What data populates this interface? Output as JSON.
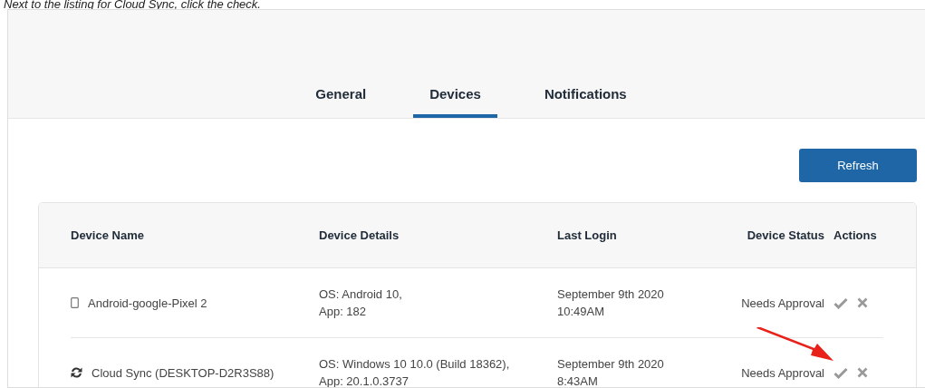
{
  "instruction": "Next to the listing for Cloud Sync, click the check.",
  "tabs": [
    {
      "label": "General",
      "selected": false
    },
    {
      "label": "Devices",
      "selected": true
    },
    {
      "label": "Notifications",
      "selected": false
    }
  ],
  "refresh_button": "Refresh",
  "table": {
    "columns": [
      "Device Name",
      "Device Details",
      "Last Login",
      "Device Status",
      "Actions"
    ],
    "rows": [
      {
        "kind": "phone",
        "name": "Android-google-Pixel 2",
        "details": [
          "OS: Android 10,",
          "App: 182"
        ],
        "last_login": [
          "September 9th 2020",
          "10:49AM"
        ],
        "status": "Needs Approval",
        "annotated": false
      },
      {
        "kind": "sync",
        "name": "Cloud Sync (DESKTOP-D2R3S88)",
        "details": [
          "OS: Windows 10 10.0 (Build 18362),",
          "App: 20.1.0.3737"
        ],
        "last_login": [
          "September 9th 2020",
          "8:43AM"
        ],
        "status": "Needs Approval",
        "annotated": true
      }
    ]
  }
}
